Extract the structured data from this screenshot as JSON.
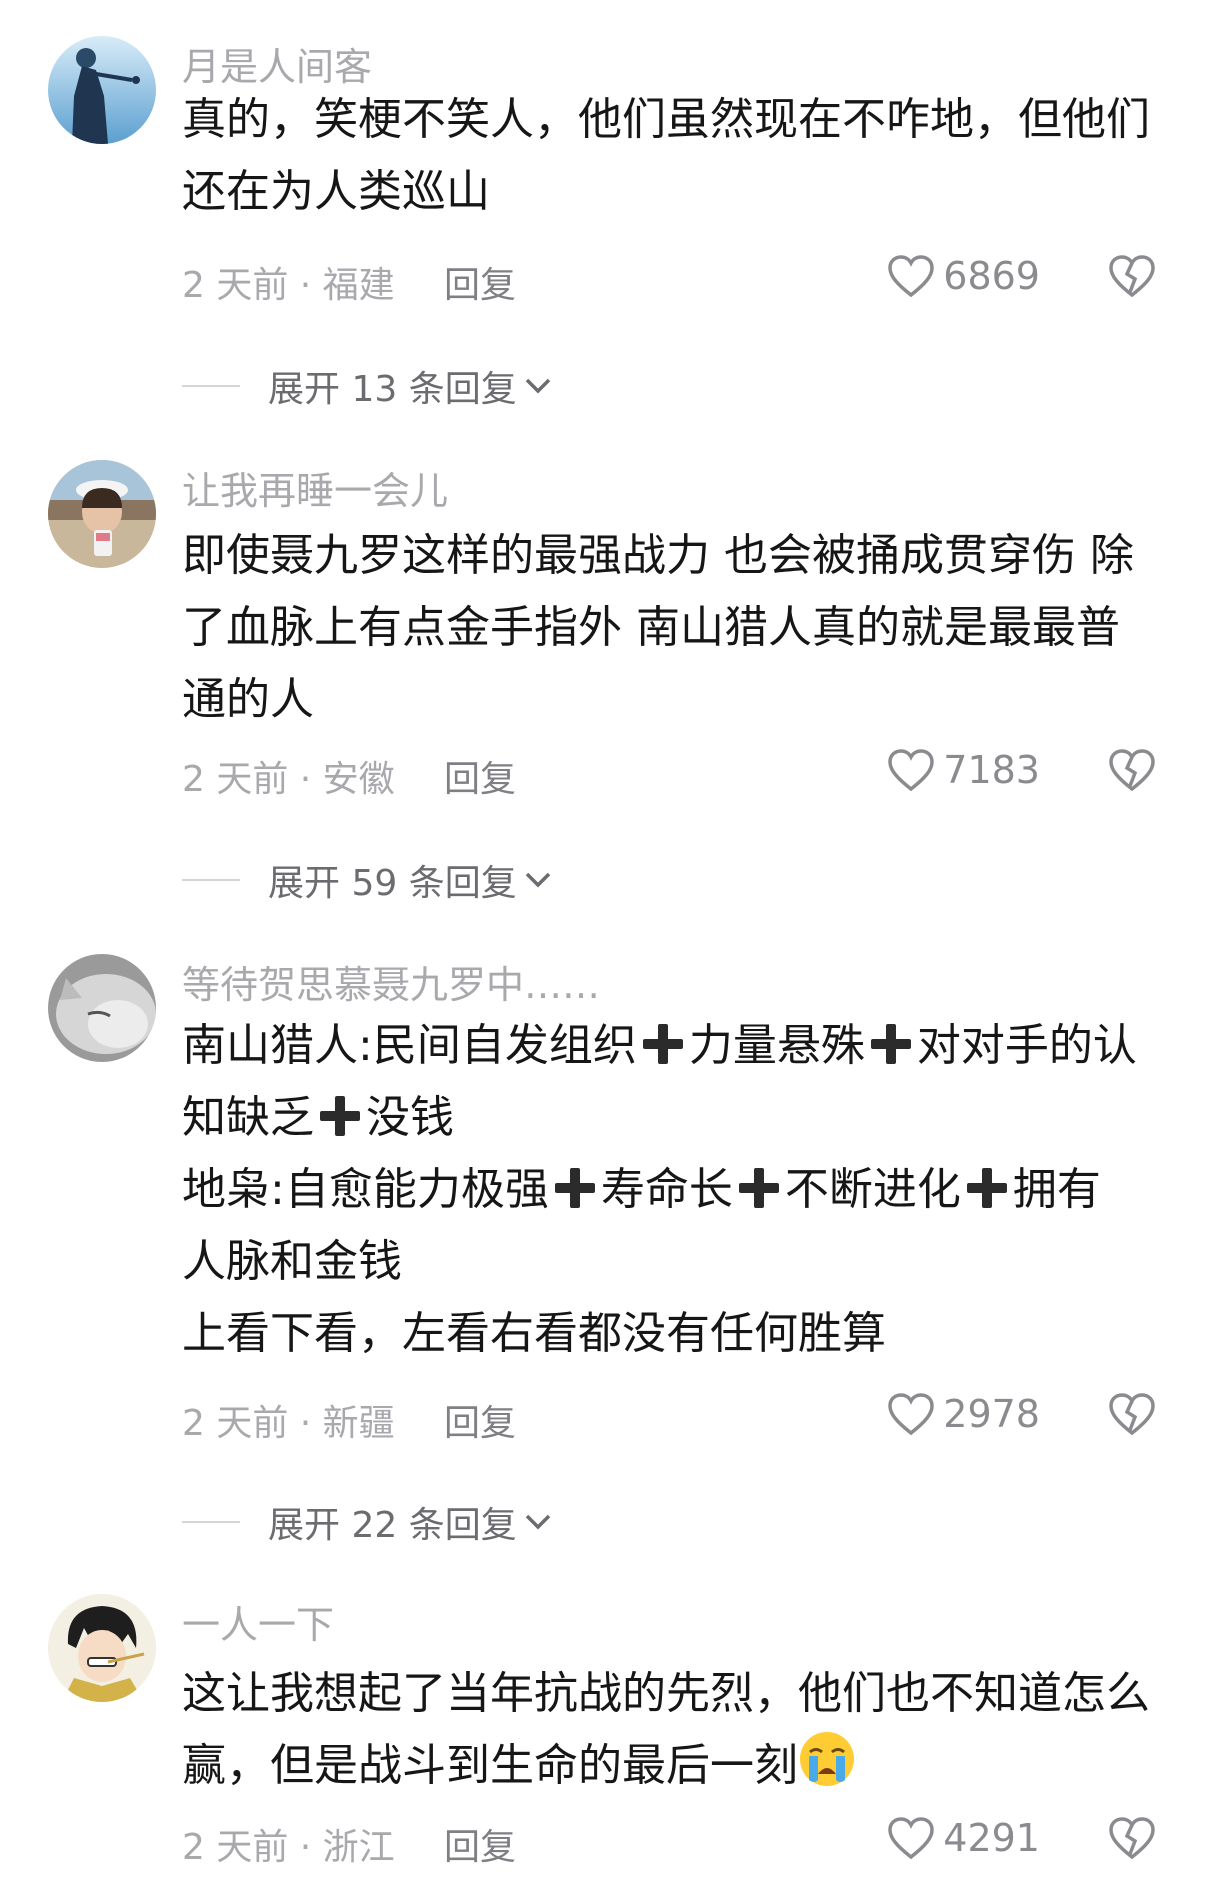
{
  "comments": [
    {
      "username": "月是人间客",
      "lines": [
        [
          {
            "t": "真的，笑梗不笑人，他们虽然现在不咋地，但他们"
          }
        ],
        [
          {
            "t": "还在为人类巡山"
          }
        ]
      ],
      "meta": "2 天前 · 福建",
      "reply": "回复",
      "likes": "6869",
      "expand": "展开 13 条回复"
    },
    {
      "username": "让我再睡一会儿",
      "lines": [
        [
          {
            "t": "即使聂九罗这样的最强战力 也会被捅成贯穿伤 除"
          }
        ],
        [
          {
            "t": "了血脉上有点金手指外 南山猎人真的就是最最普"
          }
        ],
        [
          {
            "t": "通的人"
          }
        ]
      ],
      "meta": "2 天前 · 安徽",
      "reply": "回复",
      "likes": "7183",
      "expand": "展开 59 条回复"
    },
    {
      "username": "等待贺思慕聂九罗中……",
      "lines": [
        [
          {
            "t": "南山猎人:民间自发组织"
          },
          {
            "plus": true
          },
          {
            "t": "力量悬殊"
          },
          {
            "plus": true
          },
          {
            "t": "对对手的认"
          }
        ],
        [
          {
            "t": "知缺乏"
          },
          {
            "plus": true
          },
          {
            "t": "没钱"
          }
        ],
        [
          {
            "t": "地枭:自愈能力极强"
          },
          {
            "plus": true
          },
          {
            "t": "寿命长"
          },
          {
            "plus": true
          },
          {
            "t": "不断进化"
          },
          {
            "plus": true
          },
          {
            "t": "拥有"
          }
        ],
        [
          {
            "t": "人脉和金钱"
          }
        ],
        [
          {
            "t": "上看下看，左看右看都没有任何胜算"
          }
        ]
      ],
      "meta": "2 天前 · 新疆",
      "reply": "回复",
      "likes": "2978",
      "expand": "展开 22 条回复"
    },
    {
      "username": "一人一下",
      "lines": [
        [
          {
            "t": "这让我想起了当年抗战的先烈，他们也不知道怎么"
          }
        ],
        [
          {
            "t": "赢，但是战斗到生命的最后一刻"
          },
          {
            "emoji": "loudly-crying-face-icon"
          }
        ]
      ],
      "meta": "2 天前 · 浙江",
      "reply": "回复",
      "likes": "4291",
      "expand": ""
    }
  ],
  "colors": {
    "meta_text": "#a9a9ad",
    "body_text": "#161616",
    "icon_stroke": "#8b8b8f"
  }
}
